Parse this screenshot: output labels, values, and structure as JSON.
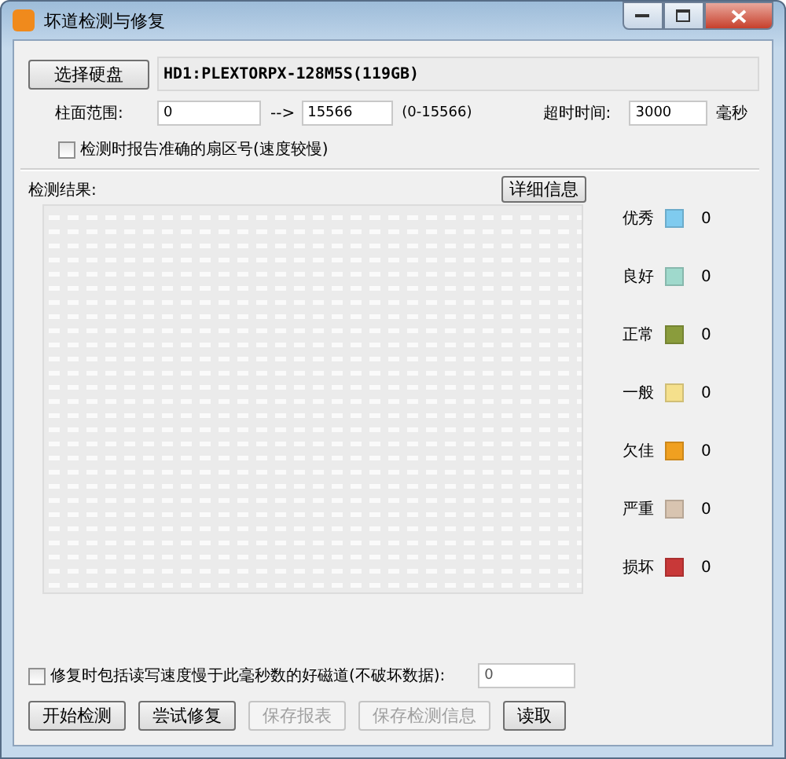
{
  "window": {
    "title": "坏道检测与修复"
  },
  "disk": {
    "button": "选择硬盘",
    "value": "HD1:PLEXTORPX-128M5S(119GB)"
  },
  "range": {
    "label": "柱面范围:",
    "from": "0",
    "arrow": "-->",
    "to": "15566",
    "hint": "(0-15566)"
  },
  "timeout": {
    "label": "超时时间:",
    "value": "3000",
    "unit": "毫秒"
  },
  "report_sector": {
    "label": "检测时报告准确的扇区号(速度较慢)",
    "checked": false
  },
  "results": {
    "label": "检测结果:",
    "details_button": "详细信息"
  },
  "legend": [
    {
      "name": "优秀",
      "color": "#7fcbef",
      "count": "0"
    },
    {
      "name": "良好",
      "color": "#9fd9cc",
      "count": "0"
    },
    {
      "name": "正常",
      "color": "#8a9c3c",
      "count": "0"
    },
    {
      "name": "一般",
      "color": "#f5e08c",
      "count": "0"
    },
    {
      "name": "欠佳",
      "color": "#f0a020",
      "count": "0"
    },
    {
      "name": "严重",
      "color": "#d8c4b0",
      "count": "0"
    },
    {
      "name": "损坏",
      "color": "#c83838",
      "count": "0"
    }
  ],
  "repair_option": {
    "label": "修复时包括读写速度慢于此毫秒数的好磁道(不破坏数据):",
    "checked": false,
    "value": "0",
    "disabled": true
  },
  "buttons": [
    {
      "label": "开始检测",
      "disabled": false
    },
    {
      "label": "尝试修复",
      "disabled": false
    },
    {
      "label": "保存报表",
      "disabled": true
    },
    {
      "label": "保存检测信息",
      "disabled": true
    },
    {
      "label": "读取",
      "disabled": false
    }
  ]
}
